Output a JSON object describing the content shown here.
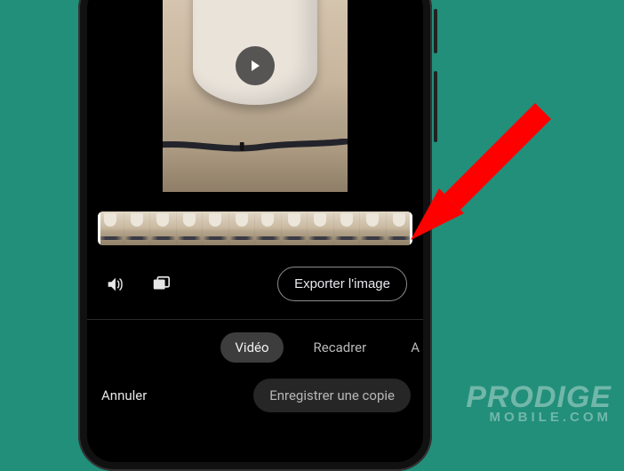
{
  "buttons": {
    "export": "Exporter l'image",
    "cancel": "Annuler",
    "save": "Enregistrer une copie"
  },
  "tabs": {
    "video": "Vidéo",
    "crop": "Recadrer",
    "adjust_partial": "A"
  },
  "icons": {
    "play": "play-icon",
    "volume": "volume-icon",
    "frames": "frames-icon"
  },
  "watermark": {
    "line1": "PRODIGE",
    "line2": "MOBILE.COM"
  },
  "colors": {
    "accent_arrow": "#ff0000",
    "bg": "#228f7a"
  },
  "timeline": {
    "thumb_count": 12
  }
}
